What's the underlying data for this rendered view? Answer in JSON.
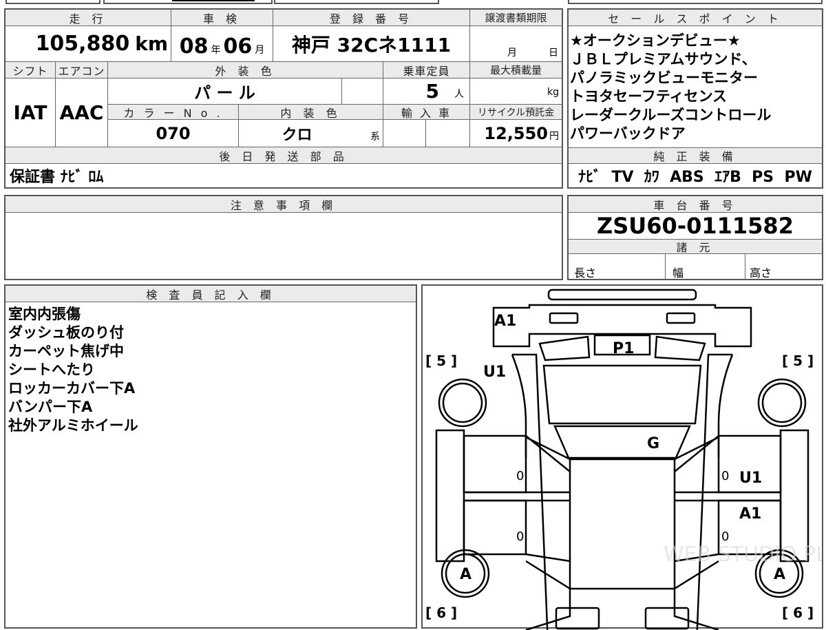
{
  "auction_sheet": {
    "headers": {
      "mileage": "走 行",
      "inspection": "車 検",
      "registration": "登 録 番 号",
      "transfer_deadline": "譲渡書類期限",
      "shift": "シフト",
      "aircon": "エアコン",
      "exterior_color": "外 装 色",
      "capacity": "乗車定員",
      "max_load": "最大積載量",
      "color_no": "カ ラ ー N o .",
      "interior_color": "内 装 色",
      "import": "輸 入 車",
      "recycle": "リサイクル預託金",
      "later_parts": "後 日 発 送 部 品",
      "notes": "注 意 事 項 欄",
      "inspector": "検 査 員 記 入 欄",
      "sales_points": "セ ー ル ス ポ イ ン ト",
      "equipment": "純 正 装 備",
      "chassis": "車 台 番 号",
      "specs": "諸 元"
    },
    "mileage_value": "105,880",
    "mileage_unit": "km",
    "inspection_year": "08",
    "inspection_year_unit": "年",
    "inspection_month": "06",
    "inspection_month_unit": "月",
    "registration_value": "神戸 32Cネ1111",
    "deadline_month_unit": "月",
    "deadline_day_unit": "日",
    "shift_value": "IAT",
    "aircon_value": "AAC",
    "exterior_color_value": "パ ー ル",
    "capacity_value": "5",
    "capacity_unit": "人",
    "max_load_unit": "kg",
    "color_no_value": "070",
    "interior_color_value": "クロ",
    "interior_color_suffix": "系",
    "recycle_value": "12,550",
    "recycle_unit": "円",
    "later_parts_value": "保証書 ﾅﾋﾞ ﾛﾑ",
    "sales_points": [
      "★オークションデビュー★",
      "ＪＢＬプレミアムサウンド、",
      "パノラミックビューモニター",
      "トヨタセーフティセンス",
      "レーダークルーズコントロール",
      "パワーバックドア"
    ],
    "equipment_value": "ﾅﾋﾞ  TV  ｶﾜ  ABS  ｴｱB  PS  PW",
    "chassis_value": "ZSU60-0111582",
    "spec_length": "長さ",
    "spec_width": "幅",
    "spec_height": "高さ",
    "inspector_notes": [
      "室内内張傷",
      "ダッシュ板のり付",
      "カーペット焦げ中",
      "シートへたり",
      "ロッカーカバー下A",
      "バンパー下A",
      "社外アルミホイール"
    ]
  },
  "diagram": {
    "marks": {
      "roof": "A1",
      "rear_window": "P1",
      "rear_left": "U1",
      "windshield": "G",
      "right_upper_door": "U1",
      "right_lower_door": "A1",
      "front_left_wheel": "A",
      "front_right_wheel": "A",
      "door_zero_1": "0",
      "door_zero_2": "0",
      "door_zero_3": "0",
      "door_zero_4": "0"
    },
    "tire_depth": {
      "rear_left": "[ 5 ]",
      "rear_right": "[ 5 ]",
      "front_left": "[ 6 ]",
      "front_right": "[ 6 ]"
    },
    "watermark": "WEB STUDIO PLUS"
  }
}
